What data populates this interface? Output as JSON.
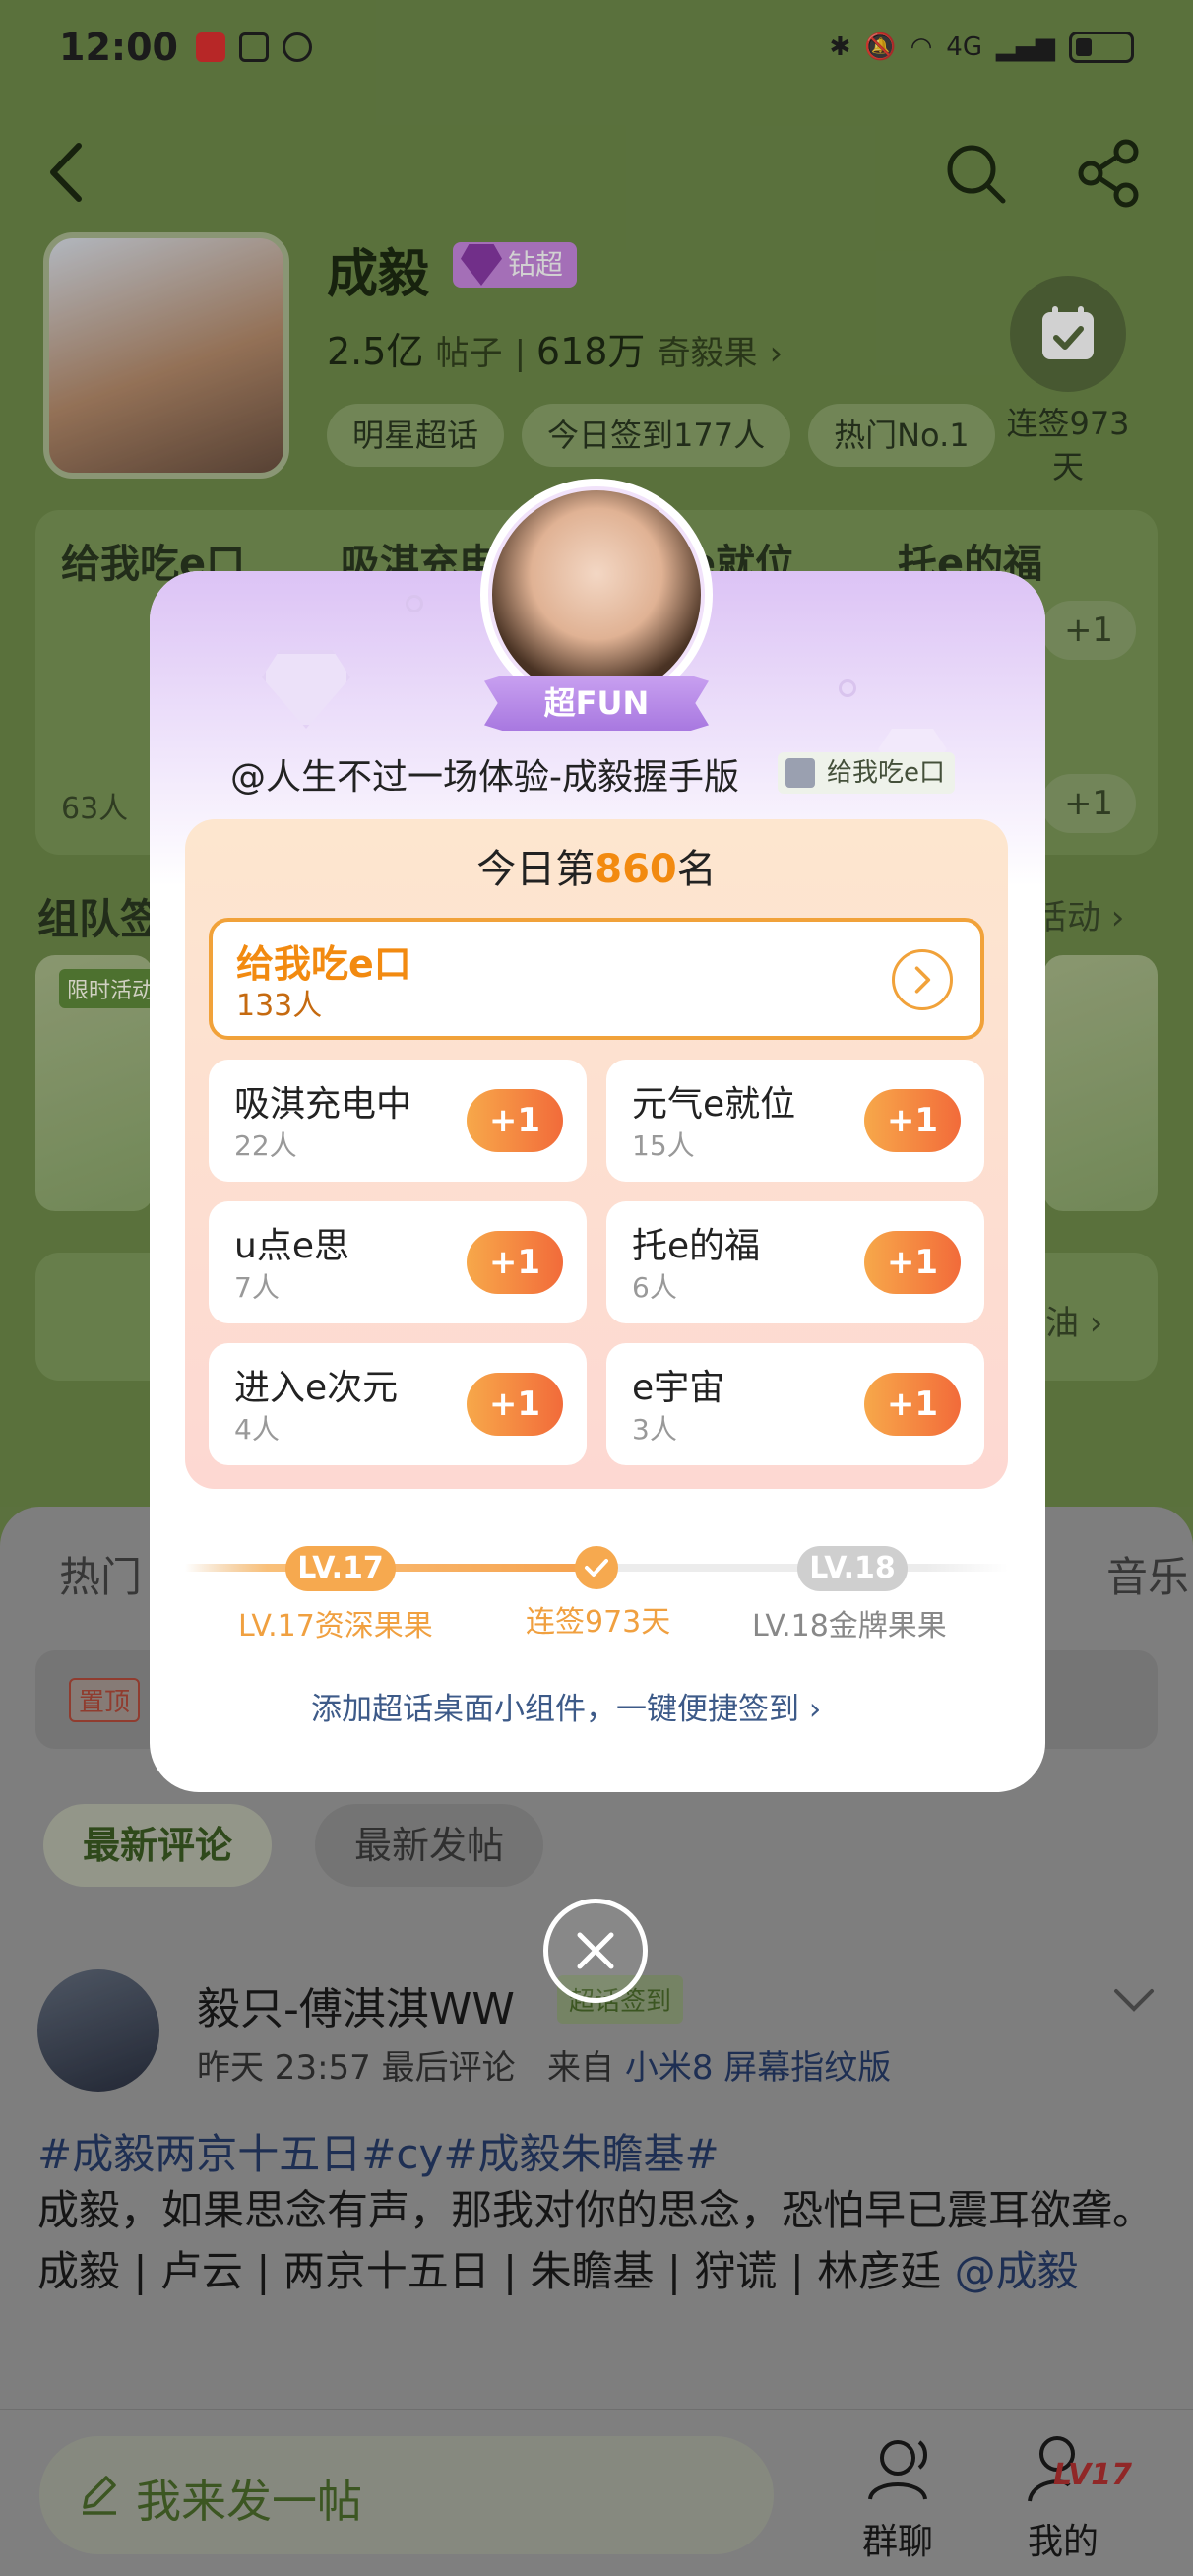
{
  "status_bar": {
    "time": "12:00",
    "network": "4G"
  },
  "profile": {
    "name": "成毅",
    "vip_badge": "钻超",
    "posts_count": "2.5亿",
    "posts_label": "帖子",
    "fans_count": "618万",
    "fans_label": "奇毅果",
    "tags": [
      "明星超话",
      "今日签到177人",
      "热门No.1"
    ],
    "checkin_streak": "连签973天"
  },
  "background": {
    "card_titles": [
      "给我吃e口",
      "吸淇充电",
      "e就位",
      "托e的福"
    ],
    "plus_label": "+1",
    "member_count": "63人",
    "team_title": "组队签",
    "team_more": "活动",
    "team_badge": "限时活动",
    "input_right": "油",
    "tab_hot": "热门",
    "tab_music": "音乐",
    "pinned_tag": "置顶",
    "sort_options": [
      "最新评论",
      "最新发帖"
    ]
  },
  "post": {
    "user": "毅只-傅淇淇WW",
    "checkin_badge": "超话签到",
    "time": "昨天 23:57",
    "meta_label": "最后评论",
    "from_label": "来自",
    "device": "小米8 屏幕指纹版",
    "topics": "#成毅两京十五日#cy#成毅朱瞻基#",
    "body_line1": "成毅，如果思念有声，那我对你的思念，恐怕早已震耳欲聋。",
    "body_line2": "成毅 | 卢云 | 两京十五日 | 朱瞻基  | 狩谎 | 林彦廷 ",
    "mention": "@成毅"
  },
  "bottom_bar": {
    "compose_label": "我来发一帖",
    "group_chat_label": "群聊",
    "me_label": "我的",
    "level_badge": "LV17"
  },
  "dialog": {
    "ribbon_label": "超FUN",
    "handle": "@人生不过一场体验-成毅握手版",
    "handle_tag": "给我吃e口",
    "rank_prefix": "今日第",
    "rank_number": "860",
    "rank_suffix": "名",
    "selected_group": {
      "name": "给我吃e口",
      "count": "133人"
    },
    "groups": [
      {
        "name": "吸淇充电中",
        "count": "22人"
      },
      {
        "name": "元气e就位",
        "count": "15人"
      },
      {
        "name": "u点e思",
        "count": "7人"
      },
      {
        "name": "托e的福",
        "count": "6人"
      },
      {
        "name": "进入e次元",
        "count": "4人"
      },
      {
        "name": "e宇宙",
        "count": "3人"
      }
    ],
    "plus_label": "+1",
    "level": {
      "current_pill": "LV.17",
      "next_pill": "LV.18",
      "current_label": "LV.17资深果果",
      "streak_label": "连签973天",
      "next_label": "LV.18金牌果果",
      "progress": 0.5
    },
    "widget_link": "添加超话桌面小组件，一键便捷签到 ›"
  },
  "colors": {
    "accent_orange": "#f28a10",
    "page_green": "#6e8a4a",
    "link_blue": "#3d5a88"
  }
}
